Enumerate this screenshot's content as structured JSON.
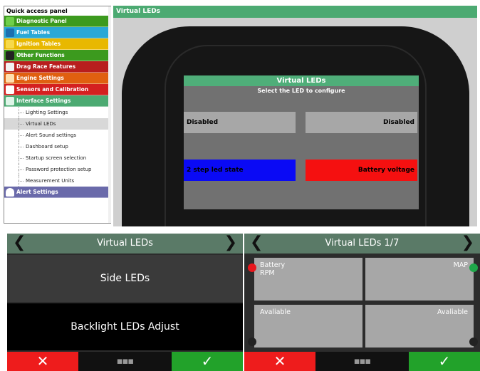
{
  "sidebar": {
    "title": "Quick access panel",
    "categories": [
      {
        "label": "Diagnostic Panel",
        "color": "#3c9a1e"
      },
      {
        "label": "Fuel Tables",
        "color": "#2aa8d6"
      },
      {
        "label": "Ignition Tables",
        "color": "#e8b800"
      },
      {
        "label": "Other Functions",
        "color": "#3c9a1e"
      },
      {
        "label": "Drag Race Features",
        "color": "#b81e1e"
      },
      {
        "label": "Engine Settings",
        "color": "#e06010"
      },
      {
        "label": "Sensors and Calibration",
        "color": "#d42020"
      },
      {
        "label": "Interface Settings",
        "color": "#4caa72"
      }
    ],
    "subitems": [
      "Lighting Settings",
      "Virtual LEDs",
      "Alert Sound settings",
      "Dashboard setup",
      "Startup screen selection",
      "Password protection setup",
      "Measurement Units"
    ],
    "alert": {
      "label": "Alert Settings",
      "color": "#6a6aaa"
    }
  },
  "main": {
    "title": "Virtual LEDs",
    "screen": {
      "title": "Virtual LEDs",
      "subtitle": "Select the LED to configure",
      "leds": [
        {
          "label": "Disabled",
          "color": "#a7a7a7",
          "text_color": "#000000"
        },
        {
          "label": "Disabled",
          "color": "#a7a7a7",
          "text_color": "#000000"
        },
        {
          "label": "2 step led state",
          "color": "#0a0af5",
          "text_color": "#000000"
        },
        {
          "label": "Battery voltage",
          "color": "#f51010",
          "text_color": "#000000"
        }
      ]
    }
  },
  "panel_left": {
    "title": "Virtual LEDs",
    "options": [
      "Side LEDs",
      "Backlight LEDs Adjust"
    ],
    "cancel_glyph": "✕",
    "menu_glyph": "▪▪▪",
    "ok_glyph": "✓"
  },
  "panel_right": {
    "title": "Virtual LEDs 1/7",
    "cells": [
      {
        "line1": "Battery",
        "line2": "RPM",
        "align": "left"
      },
      {
        "line1": "MAP",
        "line2": "",
        "align": "right"
      },
      {
        "line1": "Avaliable",
        "line2": "",
        "align": "left"
      },
      {
        "line1": "Avaliable",
        "line2": "",
        "align": "right"
      }
    ],
    "dot_colors": {
      "top_left": "#e8161c",
      "top_right": "#1fa84a",
      "bottom": "#222222"
    },
    "cancel_glyph": "✕",
    "menu_glyph": "▪▪▪",
    "ok_glyph": "✓"
  }
}
